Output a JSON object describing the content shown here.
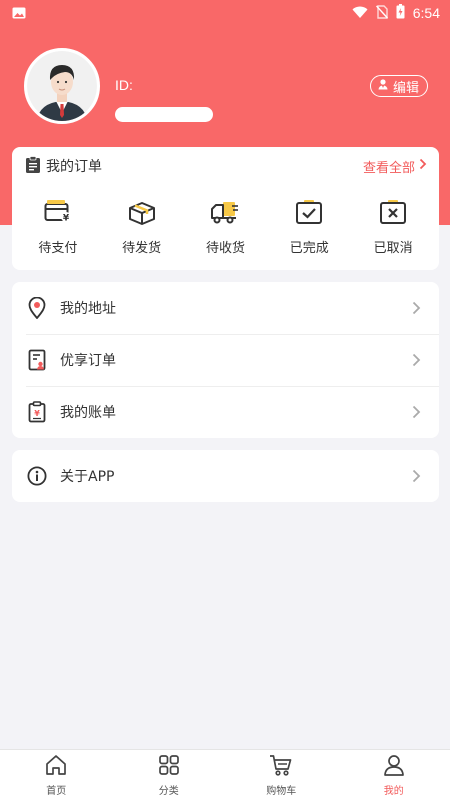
{
  "colors": {
    "brand": "#f96868",
    "accent": "#f25b5b"
  },
  "status_bar": {
    "time": "6:54"
  },
  "profile": {
    "id_label": "ID:",
    "edit_label": "编辑"
  },
  "orders": {
    "title": "我的订单",
    "view_all": "查看全部",
    "items": [
      {
        "label": "待支付",
        "icon": "wallet-icon"
      },
      {
        "label": "待发货",
        "icon": "box-icon"
      },
      {
        "label": "待收货",
        "icon": "truck-icon"
      },
      {
        "label": "已完成",
        "icon": "check-box-icon"
      },
      {
        "label": "已取消",
        "icon": "cancel-box-icon"
      }
    ]
  },
  "menu": {
    "items": [
      {
        "label": "我的地址",
        "icon": "location-icon"
      },
      {
        "label": "优享订单",
        "icon": "order-doc-icon"
      },
      {
        "label": "我的账单",
        "icon": "bill-icon"
      }
    ],
    "about": {
      "label": "关于APP",
      "icon": "info-icon"
    }
  },
  "bottom_nav": {
    "items": [
      {
        "label": "首页",
        "icon": "home-icon"
      },
      {
        "label": "分类",
        "icon": "grid-icon"
      },
      {
        "label": "购物车",
        "icon": "cart-icon"
      },
      {
        "label": "我的",
        "icon": "user-icon",
        "active": true
      }
    ]
  }
}
